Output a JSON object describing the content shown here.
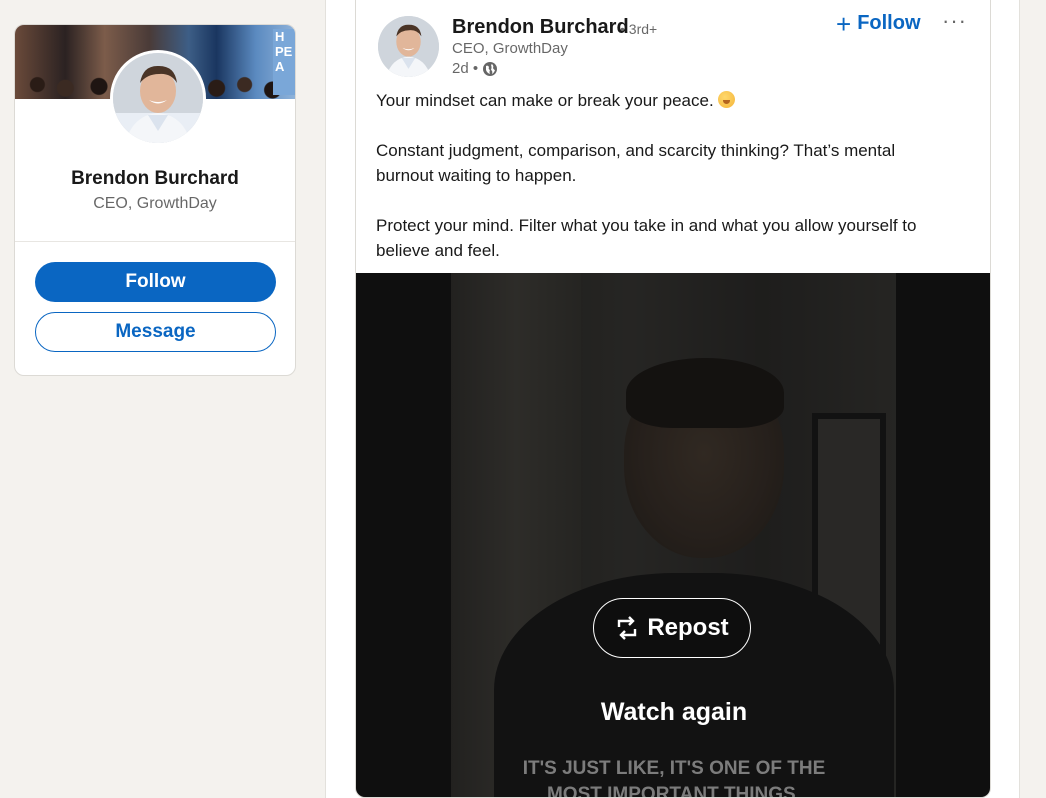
{
  "profile_card": {
    "banner_sign_text": "HI\nPE\nA",
    "name": "Brendon Burchard",
    "headline": "CEO, GrowthDay",
    "follow_label": "Follow",
    "message_label": "Message"
  },
  "post": {
    "author": "Brendon Burchard",
    "degree": "• 3rd+",
    "headline": "CEO, GrowthDay",
    "time": "2d •",
    "follow_label": "Follow",
    "more_label": "···",
    "paragraphs": [
      "Your mindset can make or break your peace.",
      "Constant judgment, comparison, and scarcity thinking? That’s mental burnout waiting to happen.",
      "Protect your mind. Filter what you take in and what you allow yourself to believe and feel."
    ],
    "video": {
      "repost_label": "Repost",
      "watch_again_label": "Watch again",
      "caption_line1": "IT'S JUST LIKE, IT'S ONE OF THE",
      "caption_line2": "MOST IMPORTANT THINGS."
    }
  },
  "colors": {
    "brand": "#0a66c2",
    "background": "#f4f2ee"
  }
}
